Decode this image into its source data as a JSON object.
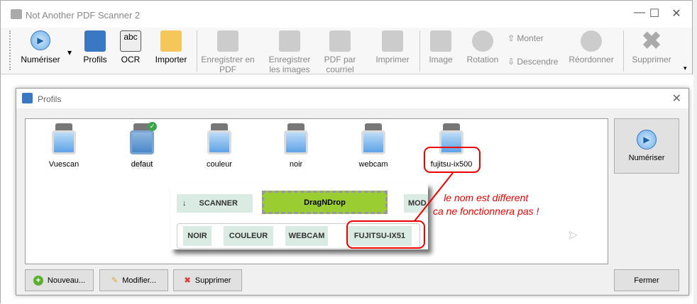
{
  "app": {
    "title": "Not Another PDF Scanner 2"
  },
  "toolbar": {
    "scan": "Numériser",
    "profiles": "Profils",
    "ocr": "OCR",
    "import": "Importer",
    "save_pdf": "Enregistrer en PDF",
    "save_images": "Enregistrer les images",
    "email_pdf": "PDF par courriel",
    "print": "Imprimer",
    "image": "Image",
    "rotation": "Rotation",
    "move_up": "Monter",
    "move_down": "Descendre",
    "reorder": "Réordonner",
    "delete": "Supprimer",
    "ocr_icon_text": "abc"
  },
  "dialog": {
    "title": "Profils",
    "profiles": [
      {
        "name": "Vuescan"
      },
      {
        "name": "defaut"
      },
      {
        "name": "couleur"
      },
      {
        "name": "noir"
      },
      {
        "name": "webcam"
      },
      {
        "name": "fujitsu-ix500"
      }
    ],
    "scan_button": "Numériser",
    "new_button": "Nouveau...",
    "edit_button": "Modifier...",
    "delete_button": "Supprimer",
    "close_button": "Fermer"
  },
  "overlay": {
    "scanner_chip": "SCANNER",
    "dnd": "DragNDrop",
    "mode_chip": "MOD",
    "chips": [
      "NOIR",
      "COULEUR",
      "WEBCAM",
      "FUJITSU-IX51"
    ]
  },
  "annotation": {
    "line1": "le nom est different",
    "line2": "ca ne fonctionnera pas !"
  },
  "colors": {
    "accent": "#3b78c4",
    "annotation": "#e00000",
    "dnd": "#9acd32"
  }
}
